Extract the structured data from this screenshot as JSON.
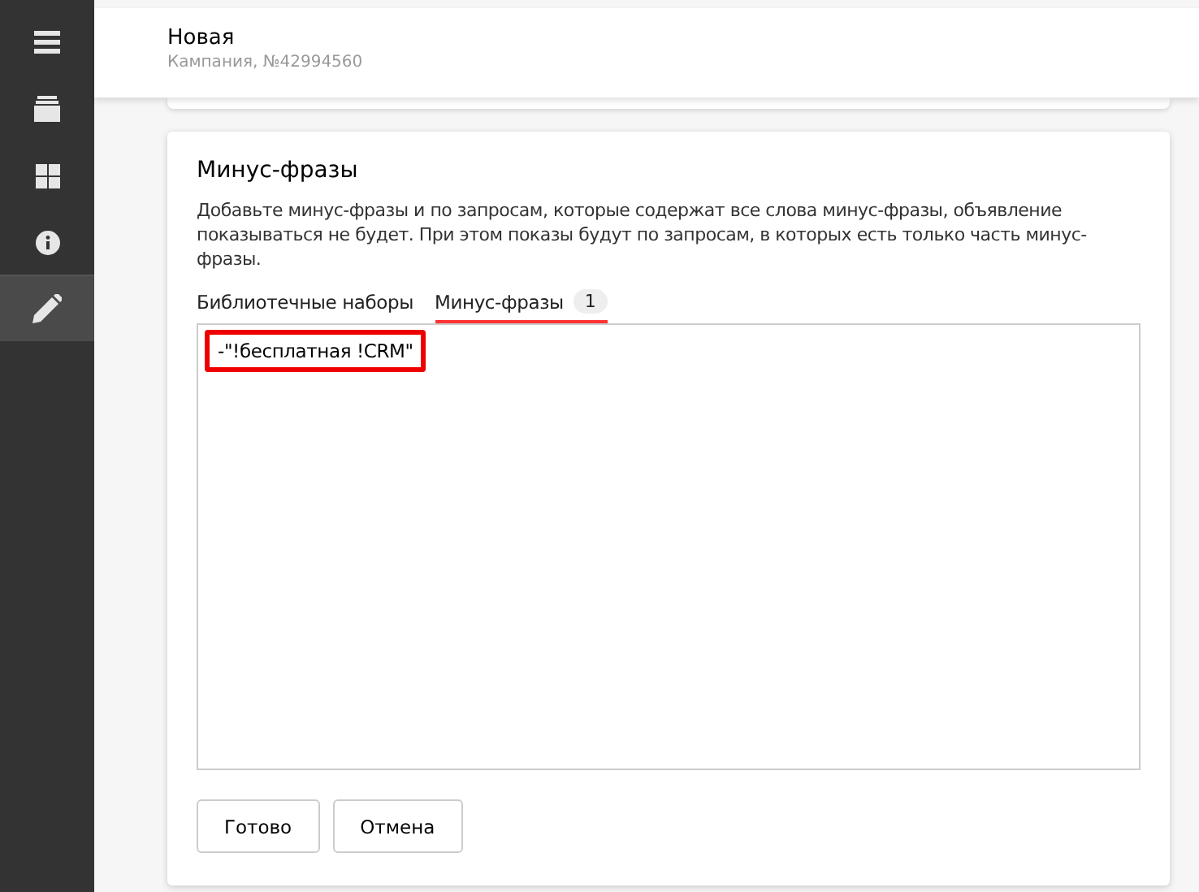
{
  "sidebar": {
    "items": [
      {
        "kind": "menu",
        "selected": false
      },
      {
        "kind": "stack",
        "selected": false
      },
      {
        "kind": "grid",
        "selected": false
      },
      {
        "kind": "info",
        "selected": false
      },
      {
        "kind": "edit",
        "selected": true
      }
    ]
  },
  "header": {
    "title": "Новая",
    "subtitle": "Кампания, №42994560"
  },
  "card": {
    "title": "Минус-фразы",
    "description": "Добавьте минус-фразы и по запросам, которые содержат все слова минус-фразы, объявление показываться не будет. При этом показы будут по запросам, в которых есть только часть минус-фразы.",
    "tabs": [
      {
        "label": "Библиотечные наборы",
        "selected": false
      },
      {
        "label": "Минус-фразы",
        "count": "1",
        "selected": true
      }
    ],
    "phrases": {
      "value": "-\"!бесплатная !CRM\"",
      "highlighted": true
    },
    "buttons": [
      "Готово",
      "Отмена"
    ]
  }
}
